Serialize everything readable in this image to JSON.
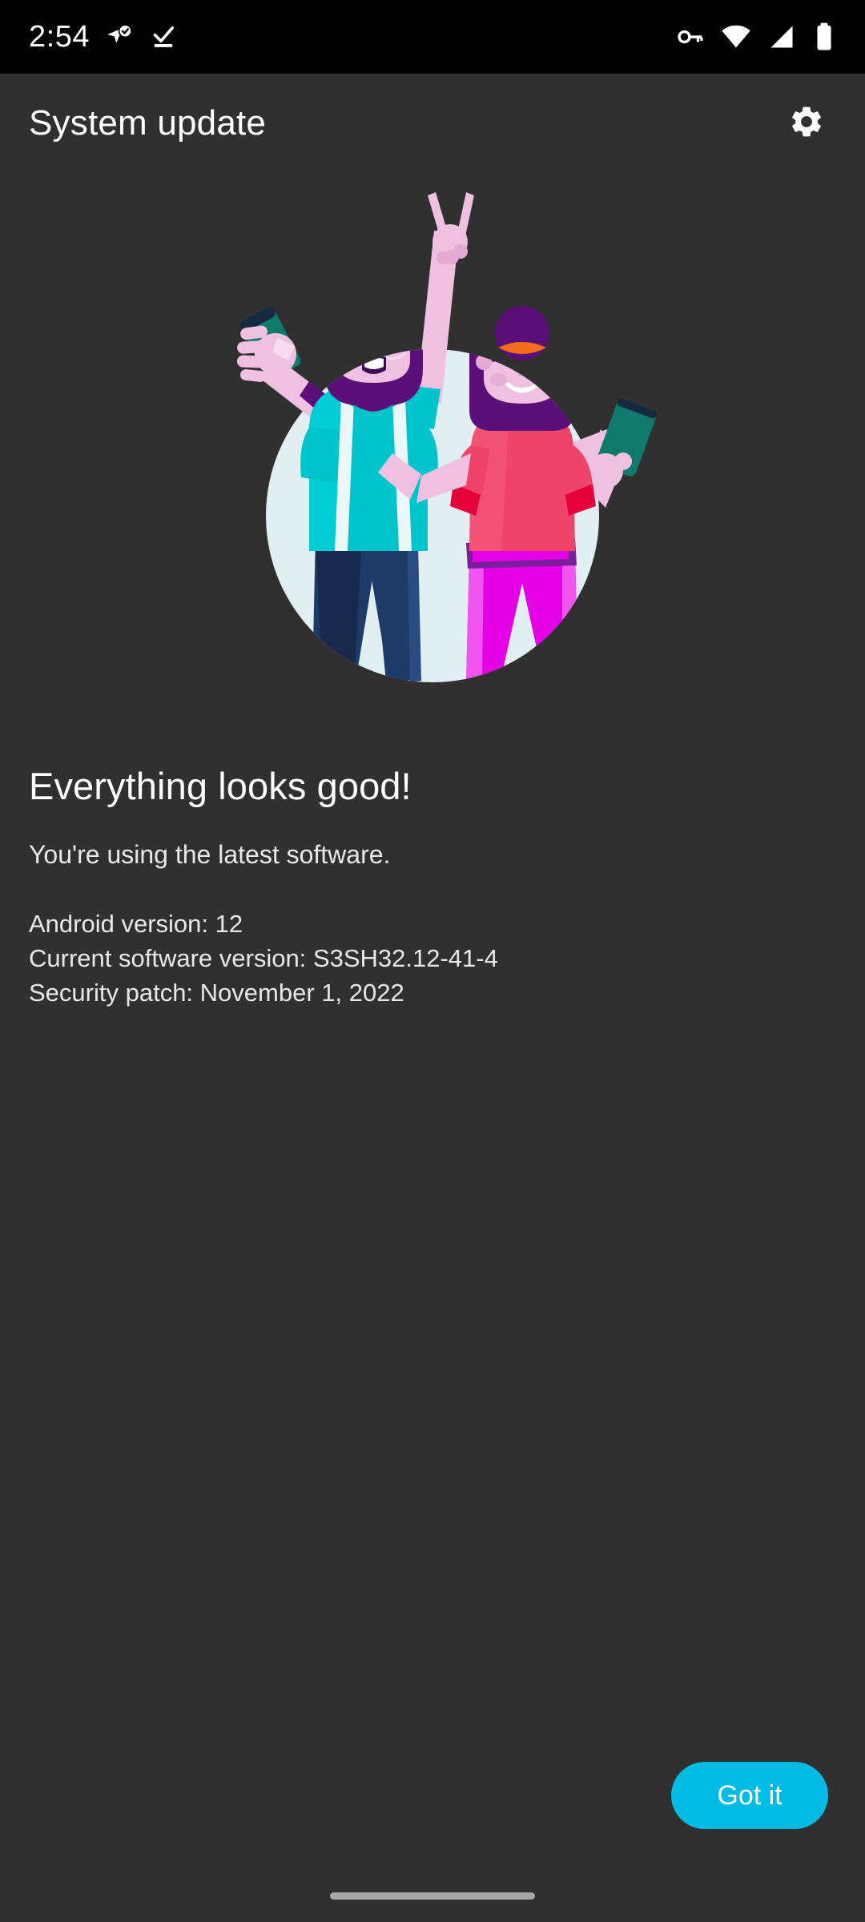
{
  "status_bar": {
    "time": "2:54",
    "left_icons": [
      {
        "name": "location-arrow-check-icon",
        "label": "location active"
      },
      {
        "name": "download-complete-icon",
        "label": "download complete"
      }
    ],
    "right_icons": [
      {
        "name": "vpn-key-icon",
        "label": "VPN"
      },
      {
        "name": "wifi-icon",
        "label": "Wi-Fi full"
      },
      {
        "name": "cellular-signal-icon",
        "label": "Mobile signal"
      },
      {
        "name": "battery-icon",
        "label": "Battery"
      }
    ],
    "background_color": "#000000"
  },
  "app_bar": {
    "title": "System update",
    "settings_icon": "gear-icon",
    "background_color": "#303030"
  },
  "illustration": {
    "name": "people-celebrating-illustration",
    "description": "Two people celebrating with phones on a pale blue circle",
    "circle_color": "#E1EEF2",
    "colors": {
      "skin": "#EFC0E0",
      "skin_shadow": "#E3A9D2",
      "hair_purple": "#5B0F78",
      "hair_purple_light": "#7A1E9E",
      "shirt_teal": "#00C4CC",
      "shirt_teal_dark": "#00A8B5",
      "suspenders": "#EAF6F8",
      "jeans_navy": "#1E3A66",
      "jeans_navy_dark": "#16294A",
      "top_coral": "#F0436A",
      "top_coral_dark": "#E5003C",
      "pants_magenta": "#E500E5",
      "pants_magenta_light": "#F055F0",
      "phone_teal": "#0F7A6B",
      "hair_tie_orange": "#F76B1C"
    }
  },
  "main": {
    "headline": "Everything looks good!",
    "subtitle": "You're using the latest software.",
    "details": [
      "Android version: 12",
      "Current software version: S3SH32.12-41-4",
      "Security patch: November 1, 2022"
    ]
  },
  "actions": {
    "got_it_label": "Got it",
    "got_it_color": "#00BCE4"
  },
  "nav_bar": {
    "home_indicator": "home-gesture-bar"
  }
}
